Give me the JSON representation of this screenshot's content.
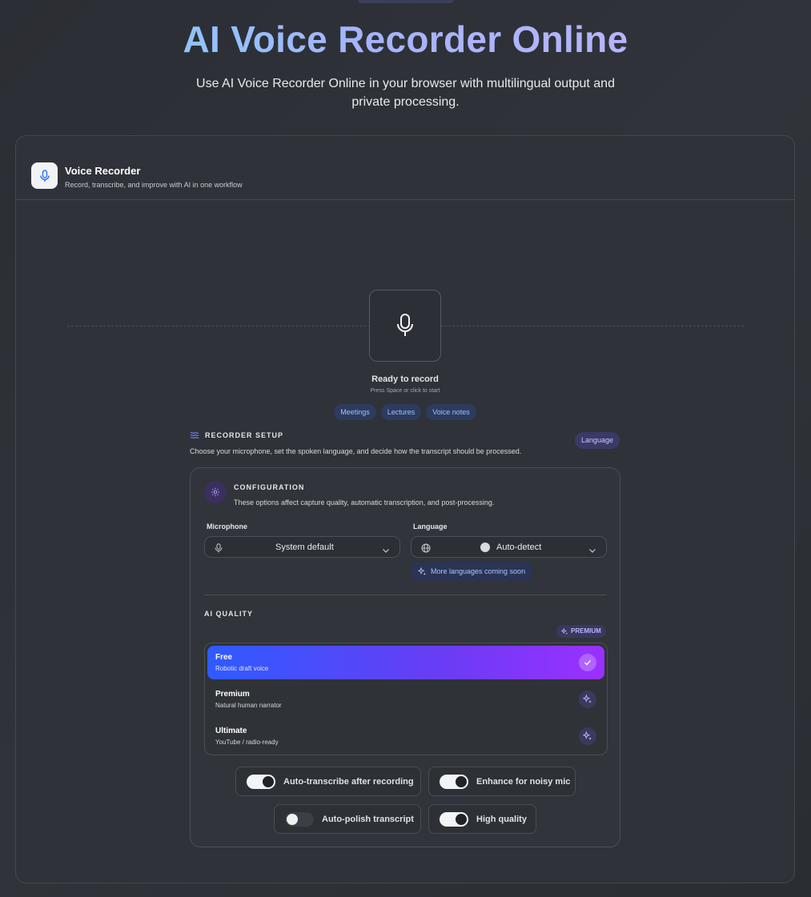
{
  "hero": {
    "title": "AI Voice Recorder Online",
    "subtitle": "Use AI Voice Recorder Online in your browser with multilingual output and private processing."
  },
  "card": {
    "title": "Voice Recorder",
    "subtitle": "Record, transcribe, and improve with AI in one workflow"
  },
  "recorder": {
    "status": "Ready to record",
    "hint": "Press Space or click to start",
    "chips": [
      "Meetings",
      "Lectures",
      "Voice notes"
    ]
  },
  "setup": {
    "title": "RECORDER SETUP",
    "description": "Choose your microphone, set the spoken language, and decide how the transcript should be processed.",
    "badge": "Language"
  },
  "configuration": {
    "title": "CONFIGURATION",
    "description": "These options affect capture quality, automatic transcription, and post-processing.",
    "microphone_label": "Microphone",
    "microphone_value": "System default",
    "language_label": "Language",
    "language_value": "Auto-detect",
    "more_languages": "More languages coming soon"
  },
  "ai_quality": {
    "title": "AI QUALITY",
    "premium_badge": "PREMIUM",
    "options": [
      {
        "name": "Free",
        "desc": "Robotic draft voice",
        "selected": true
      },
      {
        "name": "Premium",
        "desc": "Natural human narrator",
        "selected": false
      },
      {
        "name": "Ultimate",
        "desc": "YouTube / radio-ready",
        "selected": false
      }
    ]
  },
  "toggles": [
    {
      "label": "Auto-transcribe after recording",
      "on": true
    },
    {
      "label": "Enhance for noisy mic",
      "on": true
    },
    {
      "label": "Auto-polish transcript",
      "on": false
    },
    {
      "label": "High quality",
      "on": true
    }
  ],
  "colors": {
    "accent_gradient_start": "#2e5bff",
    "accent_gradient_end": "#9b30ff",
    "chip_text": "#9fc2ff"
  }
}
